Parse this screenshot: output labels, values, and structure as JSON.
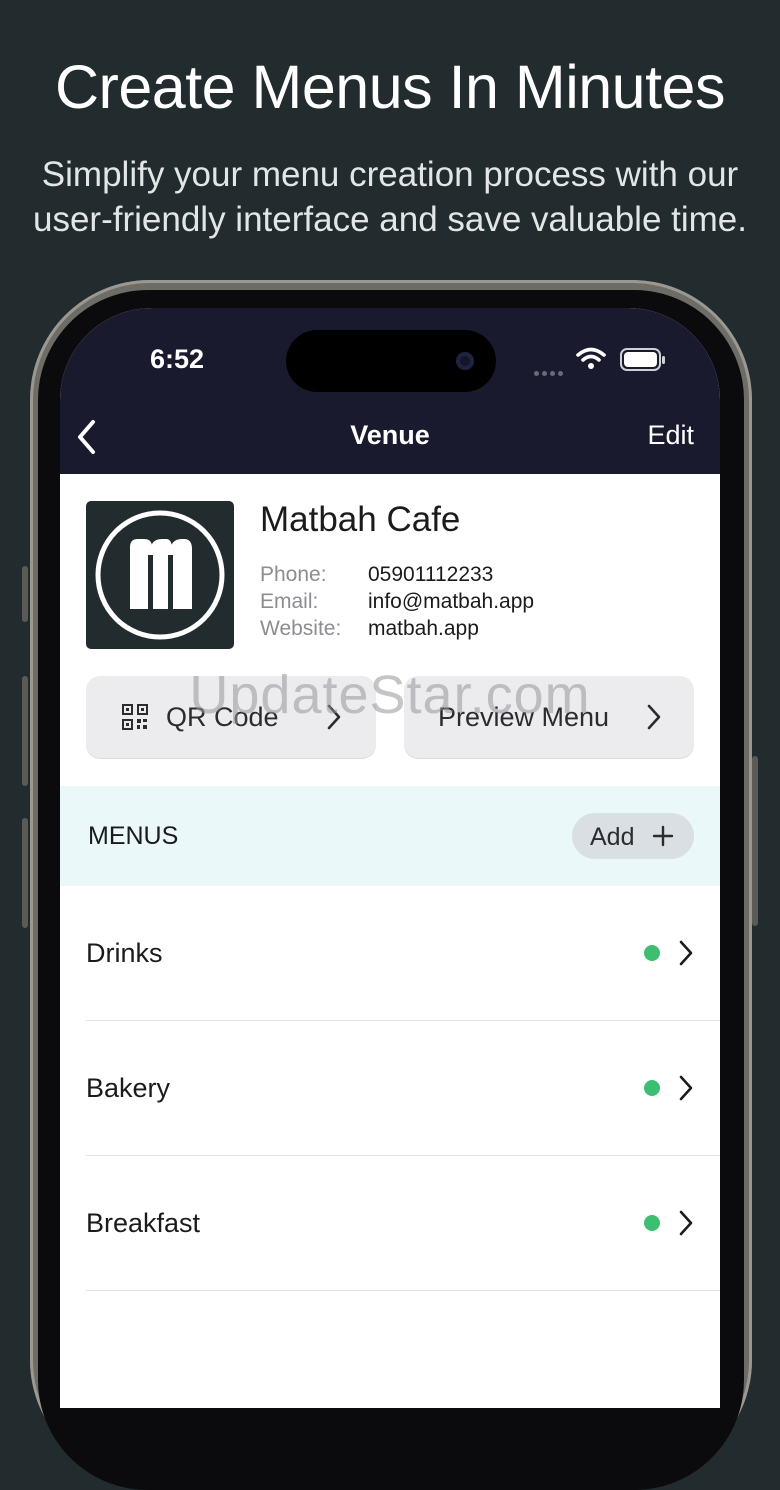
{
  "promo": {
    "headline": "Create Menus In Minutes",
    "subhead": "Simplify your menu creation process with our user-friendly interface and save valuable time."
  },
  "status_bar": {
    "time": "6:52"
  },
  "nav": {
    "title": "Venue",
    "edit_label": "Edit"
  },
  "venue": {
    "name": "Matbah Cafe",
    "phone_label": "Phone:",
    "phone": "05901112233",
    "email_label": "Email:",
    "email": "info@matbah.app",
    "website_label": "Website:",
    "website": "matbah.app"
  },
  "actions": {
    "qr_label": "QR Code",
    "preview_label": "Preview Menu"
  },
  "menus": {
    "section_title": "MENUS",
    "add_label": "Add",
    "items": [
      {
        "name": "Drinks",
        "status": "active"
      },
      {
        "name": "Bakery",
        "status": "active"
      },
      {
        "name": "Breakfast",
        "status": "active"
      }
    ]
  },
  "colors": {
    "background": "#222b2e",
    "nav_bar": "#191a2e",
    "active_dot": "#3dbf72",
    "menus_band": "#ebf8fa"
  },
  "watermark": "UpdateStar.com"
}
